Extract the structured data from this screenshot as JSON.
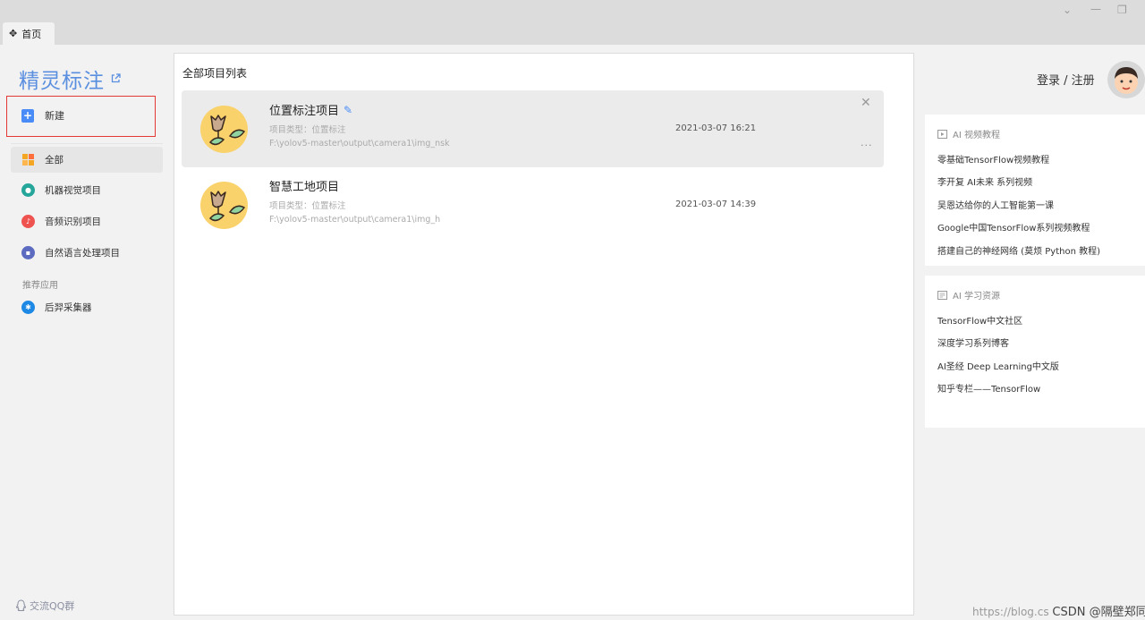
{
  "tab": {
    "label": "首页"
  },
  "sidebar": {
    "brand": "精灵标注",
    "new_label": "新建",
    "items": [
      {
        "label": "全部",
        "color": "#f5a623"
      },
      {
        "label": "机器视觉项目",
        "color": "#26a69a"
      },
      {
        "label": "音频识别项目",
        "color": "#ef5350"
      },
      {
        "label": "自然语言处理项目",
        "color": "#5c6bc0"
      }
    ],
    "section_label": "推荐应用",
    "recommended": [
      {
        "label": "后羿采集器",
        "color": "#1e88e5"
      }
    ],
    "qq_label": "交流QQ群"
  },
  "main": {
    "title": "全部项目列表",
    "projects": [
      {
        "name": "位置标注项目",
        "type": "项目类型：位置标注",
        "path": "F:\\yolov5-master\\output\\camera1\\img_nsk",
        "date": "2021-03-07 16:21"
      },
      {
        "name": "智慧工地项目",
        "type": "项目类型：位置标注",
        "path": "F:\\yolov5-master\\output\\camera1\\img_h",
        "date": "2021-03-07 14:39"
      }
    ]
  },
  "header": {
    "login": "登录 / 注册"
  },
  "video_card": {
    "title": "AI 视频教程",
    "links": [
      "零基础TensorFlow视频教程",
      "李开复 AI未来 系列视频",
      "吴恩达给你的人工智能第一课",
      "Google中国TensorFlow系列视频教程",
      "搭建自己的神经网络 (莫烦 Python 教程)"
    ]
  },
  "resource_card": {
    "title": "AI 学习资源",
    "links": [
      "TensorFlow中文社区",
      "深度学习系列博客",
      "AI圣经 Deep Learning中文版",
      "知乎专栏——TensorFlow"
    ]
  },
  "watermark": {
    "url": "https://blog.cs",
    "brand": "CSDN @隔壁郑同学"
  }
}
